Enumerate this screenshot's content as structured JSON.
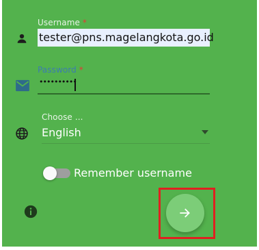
{
  "colors": {
    "panel_bg": "#53b24d",
    "field_bg": "#e8f0fe",
    "accent": "#2f6b2b",
    "required": "#e53935",
    "highlight": "#e02020",
    "fab_bg": "#7ccd78"
  },
  "username": {
    "label": "Username",
    "required_mark": "*",
    "value": "tester@pns.magelangkota.go.id",
    "icon": "person-icon"
  },
  "password": {
    "label": "Password",
    "required_mark": "*",
    "masked_value": "••••••••••",
    "icon": "envelope-icon"
  },
  "language": {
    "label": "Choose ...",
    "selected": "English",
    "icon": "globe-icon",
    "dropdown_icon": "caret-down-icon"
  },
  "remember": {
    "label": "Remember username",
    "checked": false
  },
  "info": {
    "icon": "info-icon"
  },
  "submit": {
    "icon": "arrow-right-icon"
  }
}
